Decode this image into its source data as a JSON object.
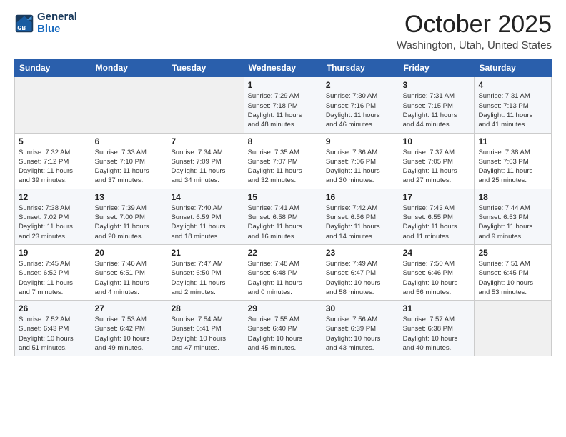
{
  "header": {
    "logo_line1": "General",
    "logo_line2": "Blue",
    "month": "October 2025",
    "location": "Washington, Utah, United States"
  },
  "days_of_week": [
    "Sunday",
    "Monday",
    "Tuesday",
    "Wednesday",
    "Thursday",
    "Friday",
    "Saturday"
  ],
  "weeks": [
    [
      {
        "day": "",
        "info": ""
      },
      {
        "day": "",
        "info": ""
      },
      {
        "day": "",
        "info": ""
      },
      {
        "day": "1",
        "info": "Sunrise: 7:29 AM\nSunset: 7:18 PM\nDaylight: 11 hours\nand 48 minutes."
      },
      {
        "day": "2",
        "info": "Sunrise: 7:30 AM\nSunset: 7:16 PM\nDaylight: 11 hours\nand 46 minutes."
      },
      {
        "day": "3",
        "info": "Sunrise: 7:31 AM\nSunset: 7:15 PM\nDaylight: 11 hours\nand 44 minutes."
      },
      {
        "day": "4",
        "info": "Sunrise: 7:31 AM\nSunset: 7:13 PM\nDaylight: 11 hours\nand 41 minutes."
      }
    ],
    [
      {
        "day": "5",
        "info": "Sunrise: 7:32 AM\nSunset: 7:12 PM\nDaylight: 11 hours\nand 39 minutes."
      },
      {
        "day": "6",
        "info": "Sunrise: 7:33 AM\nSunset: 7:10 PM\nDaylight: 11 hours\nand 37 minutes."
      },
      {
        "day": "7",
        "info": "Sunrise: 7:34 AM\nSunset: 7:09 PM\nDaylight: 11 hours\nand 34 minutes."
      },
      {
        "day": "8",
        "info": "Sunrise: 7:35 AM\nSunset: 7:07 PM\nDaylight: 11 hours\nand 32 minutes."
      },
      {
        "day": "9",
        "info": "Sunrise: 7:36 AM\nSunset: 7:06 PM\nDaylight: 11 hours\nand 30 minutes."
      },
      {
        "day": "10",
        "info": "Sunrise: 7:37 AM\nSunset: 7:05 PM\nDaylight: 11 hours\nand 27 minutes."
      },
      {
        "day": "11",
        "info": "Sunrise: 7:38 AM\nSunset: 7:03 PM\nDaylight: 11 hours\nand 25 minutes."
      }
    ],
    [
      {
        "day": "12",
        "info": "Sunrise: 7:38 AM\nSunset: 7:02 PM\nDaylight: 11 hours\nand 23 minutes."
      },
      {
        "day": "13",
        "info": "Sunrise: 7:39 AM\nSunset: 7:00 PM\nDaylight: 11 hours\nand 20 minutes."
      },
      {
        "day": "14",
        "info": "Sunrise: 7:40 AM\nSunset: 6:59 PM\nDaylight: 11 hours\nand 18 minutes."
      },
      {
        "day": "15",
        "info": "Sunrise: 7:41 AM\nSunset: 6:58 PM\nDaylight: 11 hours\nand 16 minutes."
      },
      {
        "day": "16",
        "info": "Sunrise: 7:42 AM\nSunset: 6:56 PM\nDaylight: 11 hours\nand 14 minutes."
      },
      {
        "day": "17",
        "info": "Sunrise: 7:43 AM\nSunset: 6:55 PM\nDaylight: 11 hours\nand 11 minutes."
      },
      {
        "day": "18",
        "info": "Sunrise: 7:44 AM\nSunset: 6:53 PM\nDaylight: 11 hours\nand 9 minutes."
      }
    ],
    [
      {
        "day": "19",
        "info": "Sunrise: 7:45 AM\nSunset: 6:52 PM\nDaylight: 11 hours\nand 7 minutes."
      },
      {
        "day": "20",
        "info": "Sunrise: 7:46 AM\nSunset: 6:51 PM\nDaylight: 11 hours\nand 4 minutes."
      },
      {
        "day": "21",
        "info": "Sunrise: 7:47 AM\nSunset: 6:50 PM\nDaylight: 11 hours\nand 2 minutes."
      },
      {
        "day": "22",
        "info": "Sunrise: 7:48 AM\nSunset: 6:48 PM\nDaylight: 11 hours\nand 0 minutes."
      },
      {
        "day": "23",
        "info": "Sunrise: 7:49 AM\nSunset: 6:47 PM\nDaylight: 10 hours\nand 58 minutes."
      },
      {
        "day": "24",
        "info": "Sunrise: 7:50 AM\nSunset: 6:46 PM\nDaylight: 10 hours\nand 56 minutes."
      },
      {
        "day": "25",
        "info": "Sunrise: 7:51 AM\nSunset: 6:45 PM\nDaylight: 10 hours\nand 53 minutes."
      }
    ],
    [
      {
        "day": "26",
        "info": "Sunrise: 7:52 AM\nSunset: 6:43 PM\nDaylight: 10 hours\nand 51 minutes."
      },
      {
        "day": "27",
        "info": "Sunrise: 7:53 AM\nSunset: 6:42 PM\nDaylight: 10 hours\nand 49 minutes."
      },
      {
        "day": "28",
        "info": "Sunrise: 7:54 AM\nSunset: 6:41 PM\nDaylight: 10 hours\nand 47 minutes."
      },
      {
        "day": "29",
        "info": "Sunrise: 7:55 AM\nSunset: 6:40 PM\nDaylight: 10 hours\nand 45 minutes."
      },
      {
        "day": "30",
        "info": "Sunrise: 7:56 AM\nSunset: 6:39 PM\nDaylight: 10 hours\nand 43 minutes."
      },
      {
        "day": "31",
        "info": "Sunrise: 7:57 AM\nSunset: 6:38 PM\nDaylight: 10 hours\nand 40 minutes."
      },
      {
        "day": "",
        "info": ""
      }
    ]
  ]
}
